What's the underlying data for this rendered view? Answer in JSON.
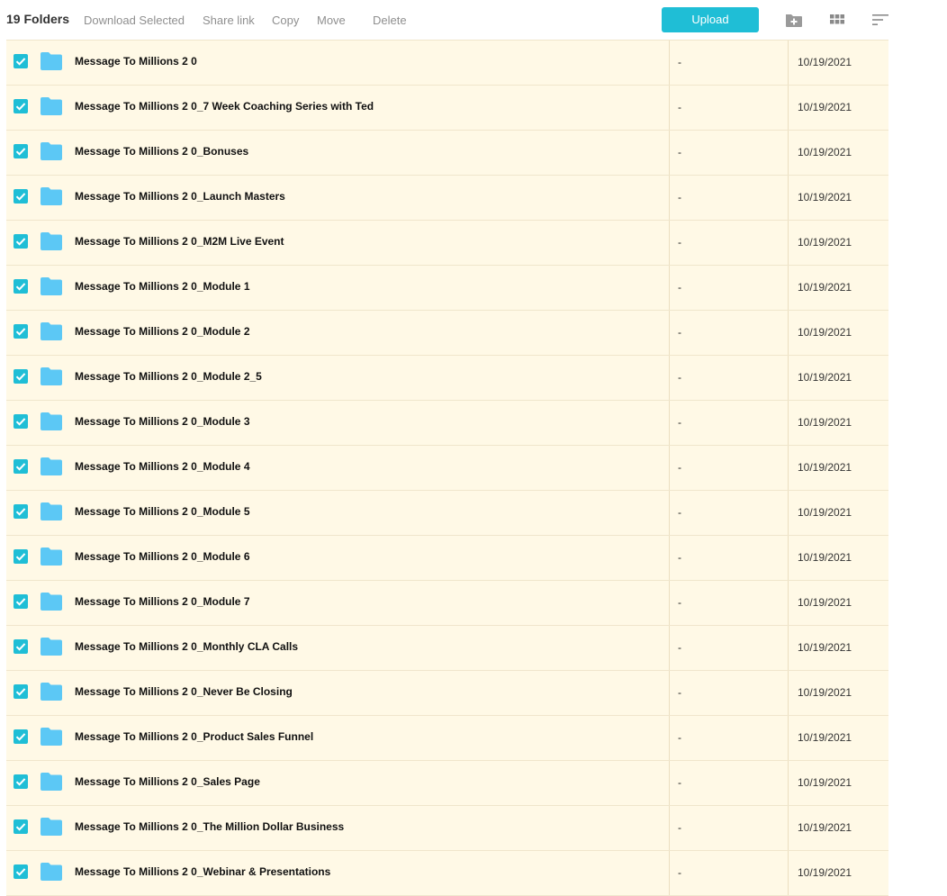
{
  "toolbar": {
    "folder_count": "19 Folders",
    "download_selected": "Download Selected",
    "share_link": "Share link",
    "copy": "Copy",
    "move": "Move",
    "delete": "Delete",
    "upload": "Upload",
    "icons": [
      "new-folder-icon",
      "grid-view-icon",
      "sort-icon"
    ]
  },
  "colors": {
    "accent": "#1fbed6",
    "row_background": "#fff9e6",
    "folder_icon": "#5cc8f5"
  },
  "folders": [
    {
      "name": "Message To Millions 2 0",
      "size": "-",
      "date": "10/19/2021",
      "checked": true
    },
    {
      "name": "Message To Millions 2 0_7 Week Coaching Series with Ted",
      "size": "-",
      "date": "10/19/2021",
      "checked": true
    },
    {
      "name": "Message To Millions 2 0_Bonuses",
      "size": "-",
      "date": "10/19/2021",
      "checked": true
    },
    {
      "name": "Message To Millions 2 0_Launch Masters",
      "size": "-",
      "date": "10/19/2021",
      "checked": true
    },
    {
      "name": "Message To Millions 2 0_M2M Live Event",
      "size": "-",
      "date": "10/19/2021",
      "checked": true
    },
    {
      "name": "Message To Millions 2 0_Module 1",
      "size": "-",
      "date": "10/19/2021",
      "checked": true
    },
    {
      "name": "Message To Millions 2 0_Module 2",
      "size": "-",
      "date": "10/19/2021",
      "checked": true
    },
    {
      "name": "Message To Millions 2 0_Module 2_5",
      "size": "-",
      "date": "10/19/2021",
      "checked": true
    },
    {
      "name": "Message To Millions 2 0_Module 3",
      "size": "-",
      "date": "10/19/2021",
      "checked": true
    },
    {
      "name": "Message To Millions 2 0_Module 4",
      "size": "-",
      "date": "10/19/2021",
      "checked": true
    },
    {
      "name": "Message To Millions 2 0_Module 5",
      "size": "-",
      "date": "10/19/2021",
      "checked": true
    },
    {
      "name": "Message To Millions 2 0_Module 6",
      "size": "-",
      "date": "10/19/2021",
      "checked": true
    },
    {
      "name": "Message To Millions 2 0_Module 7",
      "size": "-",
      "date": "10/19/2021",
      "checked": true
    },
    {
      "name": "Message To Millions 2 0_Monthly CLA Calls",
      "size": "-",
      "date": "10/19/2021",
      "checked": true
    },
    {
      "name": "Message To Millions 2 0_Never Be Closing",
      "size": "-",
      "date": "10/19/2021",
      "checked": true
    },
    {
      "name": "Message To Millions 2 0_Product Sales Funnel",
      "size": "-",
      "date": "10/19/2021",
      "checked": true
    },
    {
      "name": "Message To Millions 2 0_Sales Page",
      "size": "-",
      "date": "10/19/2021",
      "checked": true
    },
    {
      "name": "Message To Millions 2 0_The Million Dollar Business",
      "size": "-",
      "date": "10/19/2021",
      "checked": true
    },
    {
      "name": "Message To Millions 2 0_Webinar & Presentations",
      "size": "-",
      "date": "10/19/2021",
      "checked": true
    }
  ]
}
